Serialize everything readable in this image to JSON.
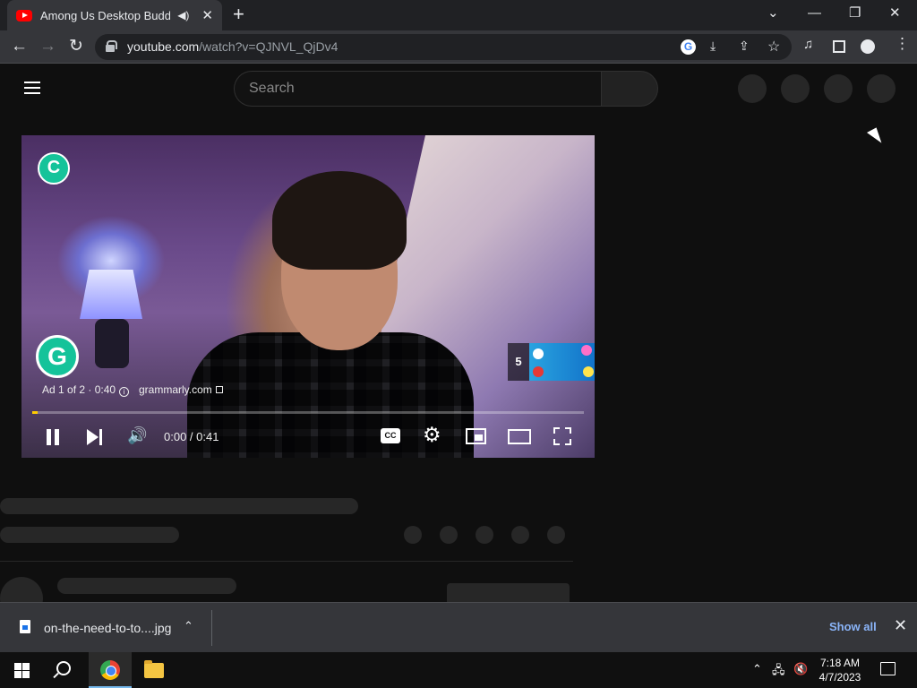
{
  "tab": {
    "title": "Among Us Desktop Buddies",
    "audio_icon": "speaker-icon",
    "close_glyph": "✕",
    "newtab_glyph": "+"
  },
  "window": {
    "dropdown_glyph": "⌄",
    "minimize_glyph": "—",
    "restore_glyph": "❐",
    "close_glyph": "✕"
  },
  "toolbar": {
    "back_glyph": "←",
    "forward_glyph": "→",
    "reload_glyph": "↻",
    "url_host": "youtube.com",
    "url_path": "/watch?v=QJNVL_QjDv4",
    "google_glyph": "G",
    "install_glyph": "⤓",
    "share_glyph": "⇪",
    "star_glyph": "☆",
    "media_glyph": "♫",
    "sidepanel_glyph": "▮",
    "menu_glyph": "⋮"
  },
  "youtube": {
    "search_placeholder": "Search"
  },
  "player": {
    "ad_text": "Ad 1 of 2 · 0:40",
    "ad_domain": "grammarly.com",
    "grammarly_letter": "G",
    "grammarly_small_letter": "C",
    "skip_countdown": "5",
    "time": "0:00 / 0:41",
    "cc_label": "CC",
    "progress_fraction": 0.01,
    "volume_glyph": "🔊",
    "settings_glyph": "⚙"
  },
  "downloads": {
    "file_name": "on-the-need-to-to....jpg",
    "chevron_glyph": "⌃",
    "show_all": "Show all",
    "close_glyph": "✕"
  },
  "taskbar": {
    "tray_chevron": "⌃",
    "network_glyph": "🖧",
    "volume_glyph": "🔇",
    "time": "7:18 AM",
    "date": "4/7/2023"
  },
  "colors": {
    "accent": "#ff0000",
    "ad_progress": "#ffcc00",
    "grammarly": "#15c39a",
    "link": "#8ab4f8"
  }
}
